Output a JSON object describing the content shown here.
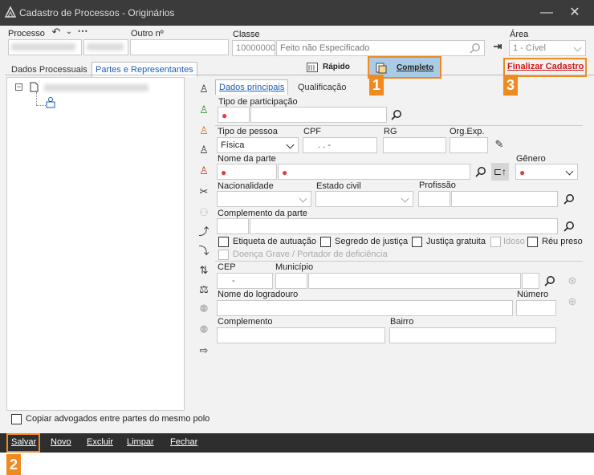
{
  "window": {
    "title": "Cadastro de Processos - Originários",
    "minimize": "—",
    "close": "✕"
  },
  "header": {
    "processo_label": "Processo",
    "outro_label": "Outro nº",
    "classe_label": "Classe",
    "classe_code": "10000000",
    "classe_desc": "Feito não Especificado",
    "area_label": "Área",
    "area_value": "1 - Cível"
  },
  "main_tabs": [
    "Dados Processuais",
    "Partes e Representantes"
  ],
  "toolbar": {
    "rapido": "Rápido",
    "completo": "Completo",
    "finalizar": "Finalizar Cadastro"
  },
  "sub_tabs": [
    "Dados principais",
    "Qualificação"
  ],
  "form": {
    "tipo_participacao": "Tipo de participação",
    "tipo_pessoa": "Tipo de pessoa",
    "tipo_pessoa_value": "Física",
    "cpf": "CPF",
    "cpf_value": ". . -",
    "rg": "RG",
    "orgexp": "Org.Exp.",
    "nome_parte": "Nome da parte",
    "genero": "Gênero",
    "nacionalidade": "Nacionalidade",
    "estado_civil": "Estado civil",
    "profissao": "Profissão",
    "complemento_parte": "Complemento da parte",
    "etiqueta": "Etiqueta de autuação",
    "segredo": "Segredo de justiça",
    "justica_gratuita": "Justiça gratuita",
    "idoso": "Idoso",
    "reu_preso": "Réu preso",
    "doenca": "Doença Grave / Portador de deficiência",
    "cep": "CEP",
    "cep_value": "-",
    "municipio": "Município",
    "logradouro": "Nome do logradouro",
    "numero": "Número",
    "complemento": "Complemento",
    "bairro": "Bairro"
  },
  "copiar": "Copiar advogados entre partes do mesmo polo",
  "bottom": {
    "salvar": "Salvar",
    "novo": "Novo",
    "excluir": "Excluir",
    "limpar": "Limpar",
    "fechar": "Fechar"
  },
  "markers": [
    "1",
    "2",
    "3"
  ],
  "colors": {
    "accent": "#f08a1f",
    "completo_bg": "#a9cbe6",
    "finalizar": "#d01818",
    "required": "#e04040"
  }
}
